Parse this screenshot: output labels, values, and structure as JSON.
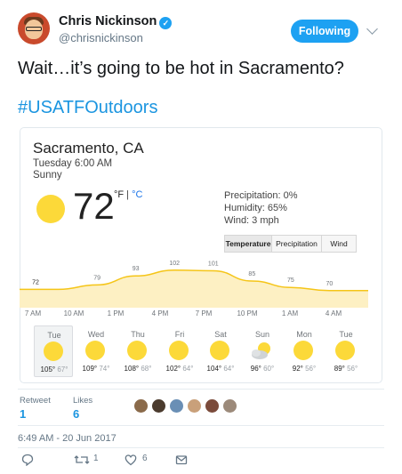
{
  "author": {
    "name": "Chris Nickinson",
    "handle": "@chrisnickinson",
    "verified_glyph": "✓",
    "follow_label": "Following"
  },
  "tweet": {
    "text": "Wait…it’s going to be hot in Sacramento?",
    "hashtag": "#USATFOutdoors",
    "timestamp": "6:49 AM - 20 Jun 2017"
  },
  "weather": {
    "location": "Sacramento, CA",
    "time": "Tuesday 6:00 AM",
    "condition": "Sunny",
    "temperature": "72",
    "unit_f": "°F",
    "unit_sep": " | ",
    "unit_c": "°C",
    "precipitation": "Precipitation: 0%",
    "humidity": "Humidity: 65%",
    "wind": "Wind: 3 mph",
    "tabs": [
      "Temperature",
      "Precipitation",
      "Wind"
    ],
    "active_tab": "Temperature"
  },
  "chart_data": {
    "type": "area",
    "x": [
      "6 AM",
      "7 AM",
      "10 AM",
      "1 PM",
      "4 PM",
      "7 PM",
      "10 PM",
      "1 AM",
      "4 AM",
      "6 AM"
    ],
    "values": [
      72,
      72,
      79,
      93,
      102,
      101,
      85,
      75,
      70,
      70
    ],
    "labels": [
      "72",
      "79",
      "93",
      "102",
      "101",
      "85",
      "75",
      "70"
    ],
    "hour_labels": [
      "7 AM",
      "10 AM",
      "1 PM",
      "4 PM",
      "7 PM",
      "10 PM",
      "1 AM",
      "4 AM"
    ],
    "ylim": [
      60,
      110
    ],
    "fill_color": "#fdf0c3",
    "line_color": "#f5c518"
  },
  "forecast": [
    {
      "day": "Tue",
      "hi": "105°",
      "lo": "67°",
      "icon": "sun-icon",
      "selected": true
    },
    {
      "day": "Wed",
      "hi": "109°",
      "lo": "74°",
      "icon": "sun-icon"
    },
    {
      "day": "Thu",
      "hi": "108°",
      "lo": "68°",
      "icon": "sun-icon"
    },
    {
      "day": "Fri",
      "hi": "102°",
      "lo": "64°",
      "icon": "sun-icon"
    },
    {
      "day": "Sat",
      "hi": "104°",
      "lo": "64°",
      "icon": "sun-icon"
    },
    {
      "day": "Sun",
      "hi": "96°",
      "lo": "60°",
      "icon": "partly-cloudy-icon"
    },
    {
      "day": "Mon",
      "hi": "92°",
      "lo": "56°",
      "icon": "sun-icon"
    },
    {
      "day": "Tue",
      "hi": "89°",
      "lo": "56°",
      "icon": "sun-icon"
    }
  ],
  "stats": {
    "retweets_label": "Retweet",
    "retweets_count": "1",
    "likes_label": "Likes",
    "likes_count": "6"
  },
  "actions": {
    "retweet_count": "1",
    "like_count": "6"
  },
  "likers": [
    "#8a6a4a",
    "#4b3b2e",
    "#6a8fb5",
    "#c9a07a",
    "#7b4b3b",
    "#9c8a7a"
  ],
  "colors": {
    "accent": "#1da1f2",
    "link": "#1b95e0",
    "sun": "#fcd939"
  }
}
